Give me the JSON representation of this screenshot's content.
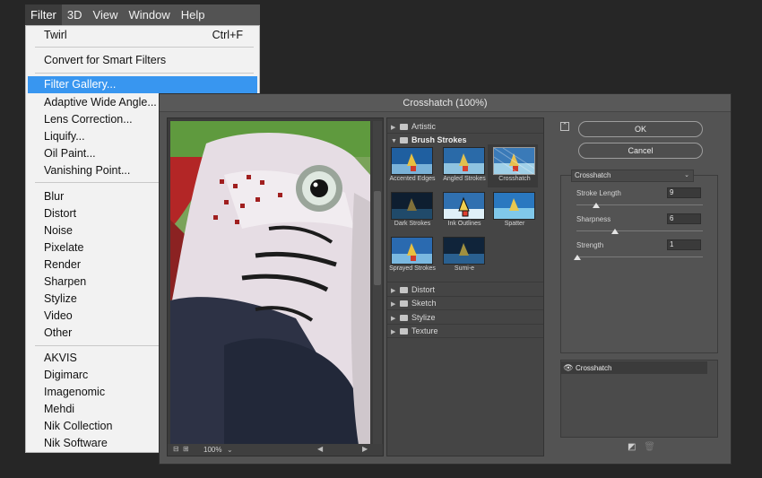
{
  "menubar": {
    "items": [
      {
        "label": "Filter",
        "active": true
      },
      {
        "label": "3D"
      },
      {
        "label": "View"
      },
      {
        "label": "Window"
      },
      {
        "label": "Help"
      }
    ]
  },
  "menu": {
    "last_filter": "Twirl",
    "last_filter_shortcut": "Ctrl+F",
    "convert_smart": "Convert for Smart Filters",
    "filter_gallery": "Filter Gallery...",
    "adaptive_wide_angle": "Adaptive Wide Angle...",
    "lens_correction": "Lens Correction...",
    "liquify": "Liquify...",
    "oil_paint": "Oil Paint...",
    "vanishing_point": "Vanishing Point...",
    "groups": [
      "Blur",
      "Distort",
      "Noise",
      "Pixelate",
      "Render",
      "Sharpen",
      "Stylize",
      "Video",
      "Other"
    ],
    "plugins": [
      "AKVIS",
      "Digimarc",
      "Imagenomic",
      "Mehdi",
      "Nik Collection",
      "Nik Software"
    ]
  },
  "dialog": {
    "title": "Crosshatch (100%)",
    "zoom": "100%",
    "categories": {
      "artistic": "Artistic",
      "brush_strokes": "Brush Strokes",
      "distort": "Distort",
      "sketch": "Sketch",
      "stylize": "Stylize",
      "texture": "Texture"
    },
    "thumbnails": [
      "Accented Edges",
      "Angled Strokes",
      "Crosshatch",
      "Dark Strokes",
      "Ink Outlines",
      "Spatter",
      "Sprayed Strokes",
      "Sumi-e"
    ],
    "selected_thumbnail": "Crosshatch",
    "ok_label": "OK",
    "cancel_label": "Cancel",
    "filter_select": "Crosshatch",
    "params": [
      {
        "label": "Stroke Length",
        "value": "9",
        "level": 0.15
      },
      {
        "label": "Sharpness",
        "value": "6",
        "level": 0.3
      },
      {
        "label": "Strength",
        "value": "1",
        "level": 0.0
      }
    ],
    "layer_name": "Crosshatch"
  },
  "colors": {
    "highlight": "#3896f0",
    "dialog_bg": "#535353",
    "menu_bg": "#f2f2f2"
  }
}
